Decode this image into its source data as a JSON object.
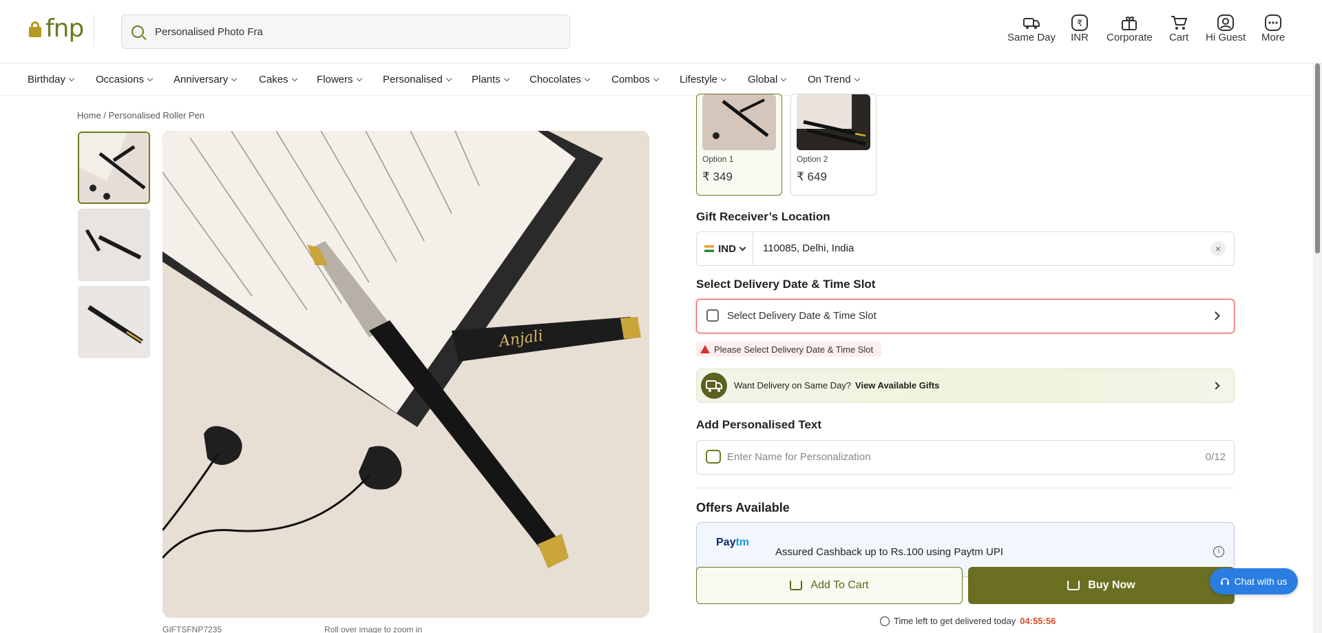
{
  "header": {
    "logo_text": "fnp",
    "search_value": "Personalised Photo Fra",
    "nav": [
      {
        "label": "Same Day",
        "icon": "truck-icon"
      },
      {
        "label": "INR",
        "icon": "rupee-icon"
      },
      {
        "label": "Corporate",
        "icon": "gift-icon"
      },
      {
        "label": "Cart",
        "icon": "cart-icon"
      },
      {
        "label": "Hi Guest",
        "icon": "user-icon"
      },
      {
        "label": "More",
        "icon": "more-icon"
      }
    ]
  },
  "categories": [
    "Birthday",
    "Occasions",
    "Anniversary",
    "Cakes",
    "Flowers",
    "Personalised",
    "Plants",
    "Chocolates",
    "Combos",
    "Lifestyle",
    "Global",
    "On Trend"
  ],
  "breadcrumb": {
    "home": "Home",
    "sep": "/",
    "current": "Personalised Roller Pen"
  },
  "product": {
    "sku": "GIFTSFNP7235",
    "zoom_hint": "Roll over image to zoom in",
    "engraving": "Anjali"
  },
  "options": [
    {
      "label": "Option 1",
      "price": "₹ 349",
      "selected": true
    },
    {
      "label": "Option 2",
      "price": "₹ 649",
      "selected": false
    }
  ],
  "location": {
    "title": "Gift Receiver’s Location",
    "country": "IND",
    "value": "110085, Delhi, India",
    "clear": "×"
  },
  "delivery": {
    "title": "Select Delivery Date & Time Slot",
    "placeholder": "Select Delivery Date & Time Slot",
    "error": "Please Select Delivery Date & Time Slot"
  },
  "same_day": {
    "text": "Want Delivery on Same Day?",
    "link": "View Available Gifts"
  },
  "personalisation": {
    "title": "Add Personalised Text",
    "placeholder": "Enter Name for Personalization",
    "count": "0/12"
  },
  "offers": {
    "title": "Offers Available",
    "brand": "Paytm",
    "brand_a": "Pay",
    "brand_b": "tm",
    "text": "Assured Cashback up to Rs.100 using Paytm UPI",
    "info": "i"
  },
  "actions": {
    "add_to_cart": "Add To Cart",
    "buy_now": "Buy Now"
  },
  "timer": {
    "label": "Time left to get delivered today",
    "value": "04:55:56"
  },
  "chat": {
    "label": "Chat with us"
  },
  "colors": {
    "brand": "#6b7a1f",
    "buy": "#6b6f22",
    "error": "#e04b4b",
    "chat": "#2a7de1"
  }
}
